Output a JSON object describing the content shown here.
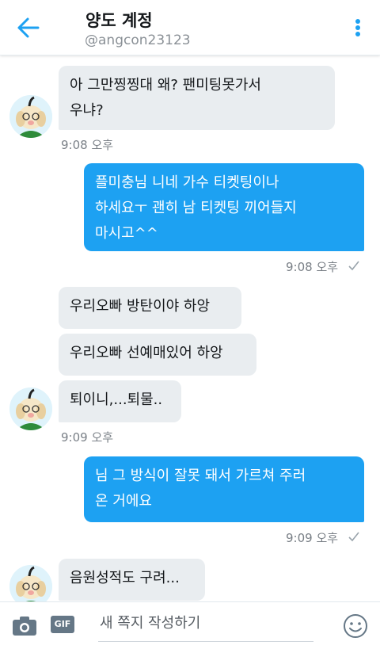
{
  "header": {
    "title": "양도 계정",
    "handle": "@angcon23123"
  },
  "messages": [
    {
      "side": "in",
      "text_lines": [
        "아 그만찡찡대 왜? 팬미팅못가서",
        "우냐?"
      ]
    },
    {
      "side": "in_time",
      "time": "9:08 오후"
    },
    {
      "side": "out",
      "text_lines": [
        "플미충님 니네 가수 티켓팅이나",
        "하세요ㅜ 괜히 남 티켓팅 끼어들지",
        "마시고^^"
      ],
      "time": "9:08 오후"
    },
    {
      "side": "in",
      "text": "우리오빠 방탄이야 하앙"
    },
    {
      "side": "in",
      "text": "우리오빠 선예매있어 하앙"
    },
    {
      "side": "in",
      "text": "퇴이니,...퇴물..",
      "time": "9:09 오후"
    },
    {
      "side": "out",
      "text_lines": [
        "님 그 방식이 잘못 돼서 가르쳐 주러",
        "온 거에요"
      ],
      "time": "9:09 오후"
    },
    {
      "side": "in",
      "text": "음원성적도 구려..."
    }
  ],
  "composer": {
    "placeholder": "새 쪽지 작성하기",
    "gif_label": "GIF"
  },
  "colors": {
    "accent": "#1da1f2",
    "incoming_bubble": "#e9edf0"
  }
}
